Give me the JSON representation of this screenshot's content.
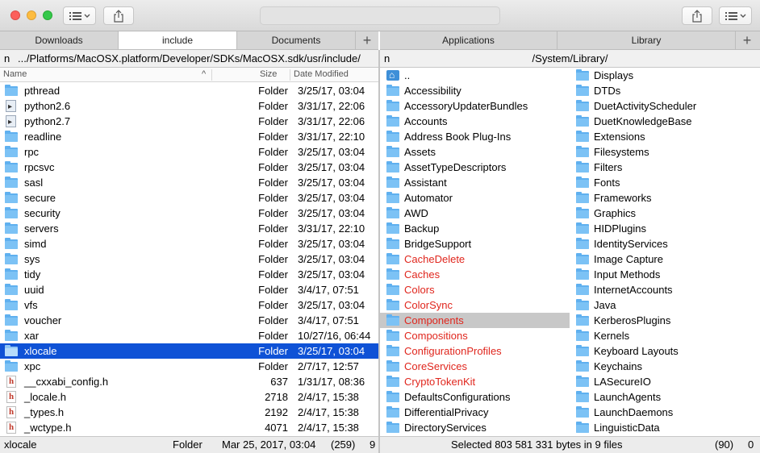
{
  "toolbar": {
    "left_view_icon": "list-view-icon",
    "left_share_icon": "share-icon",
    "right_share_icon": "share-icon",
    "right_view_icon": "list-view-icon"
  },
  "left_tabs": [
    "Downloads",
    "include",
    "Documents"
  ],
  "right_tabs": [
    "Applications",
    "Library"
  ],
  "plus": "+",
  "left_path": {
    "n": "n",
    "path": ".../Platforms/MacOSX.platform/Developer/SDKs/MacOSX.sdk/usr/include/"
  },
  "right_path": {
    "n": "n",
    "path": "/System/Library/"
  },
  "columns": {
    "name": "Name",
    "size": "Size",
    "date": "Date Modified",
    "sort_arrow": "^"
  },
  "left_files": [
    {
      "name": "pthread",
      "size": "Folder",
      "date": "3/25/17, 03:04",
      "icon": "folder"
    },
    {
      "name": "python2.6",
      "size": "Folder",
      "date": "3/31/17, 22:06",
      "icon": "alias"
    },
    {
      "name": "python2.7",
      "size": "Folder",
      "date": "3/31/17, 22:06",
      "icon": "alias"
    },
    {
      "name": "readline",
      "size": "Folder",
      "date": "3/31/17, 22:10",
      "icon": "folder"
    },
    {
      "name": "rpc",
      "size": "Folder",
      "date": "3/25/17, 03:04",
      "icon": "folder"
    },
    {
      "name": "rpcsvc",
      "size": "Folder",
      "date": "3/25/17, 03:04",
      "icon": "folder"
    },
    {
      "name": "sasl",
      "size": "Folder",
      "date": "3/25/17, 03:04",
      "icon": "folder"
    },
    {
      "name": "secure",
      "size": "Folder",
      "date": "3/25/17, 03:04",
      "icon": "folder"
    },
    {
      "name": "security",
      "size": "Folder",
      "date": "3/25/17, 03:04",
      "icon": "folder"
    },
    {
      "name": "servers",
      "size": "Folder",
      "date": "3/31/17, 22:10",
      "icon": "folder"
    },
    {
      "name": "simd",
      "size": "Folder",
      "date": "3/25/17, 03:04",
      "icon": "folder"
    },
    {
      "name": "sys",
      "size": "Folder",
      "date": "3/25/17, 03:04",
      "icon": "folder"
    },
    {
      "name": "tidy",
      "size": "Folder",
      "date": "3/25/17, 03:04",
      "icon": "folder"
    },
    {
      "name": "uuid",
      "size": "Folder",
      "date": "3/4/17, 07:51",
      "icon": "folder"
    },
    {
      "name": "vfs",
      "size": "Folder",
      "date": "3/25/17, 03:04",
      "icon": "folder"
    },
    {
      "name": "voucher",
      "size": "Folder",
      "date": "3/4/17, 07:51",
      "icon": "folder"
    },
    {
      "name": "xar",
      "size": "Folder",
      "date": "10/27/16, 06:44",
      "icon": "folder"
    },
    {
      "name": "xlocale",
      "size": "Folder",
      "date": "3/25/17, 03:04",
      "icon": "folder",
      "selected": true
    },
    {
      "name": "xpc",
      "size": "Folder",
      "date": "2/7/17, 12:57",
      "icon": "folder"
    },
    {
      "name": "__cxxabi_config.h",
      "size": "637",
      "date": "1/31/17, 08:36",
      "icon": "hfile"
    },
    {
      "name": "_locale.h",
      "size": "2718",
      "date": "2/4/17, 15:38",
      "icon": "hfile"
    },
    {
      "name": "_types.h",
      "size": "2192",
      "date": "2/4/17, 15:38",
      "icon": "hfile"
    },
    {
      "name": "_wctype.h",
      "size": "4071",
      "date": "2/4/17, 15:38",
      "icon": "hfile"
    }
  ],
  "right_col1": [
    {
      "name": "..",
      "icon": "up"
    },
    {
      "name": "Accessibility"
    },
    {
      "name": "AccessoryUpdaterBundles"
    },
    {
      "name": "Accounts"
    },
    {
      "name": "Address Book Plug-Ins"
    },
    {
      "name": "Assets"
    },
    {
      "name": "AssetTypeDescriptors"
    },
    {
      "name": "Assistant"
    },
    {
      "name": "Automator"
    },
    {
      "name": "AWD"
    },
    {
      "name": "Backup"
    },
    {
      "name": "BridgeSupport"
    },
    {
      "name": "CacheDelete",
      "red": true
    },
    {
      "name": "Caches",
      "red": true
    },
    {
      "name": "Colors",
      "red": true
    },
    {
      "name": "ColorSync",
      "red": true
    },
    {
      "name": "Components",
      "red": true,
      "highlight": true
    },
    {
      "name": "Compositions",
      "red": true
    },
    {
      "name": "ConfigurationProfiles",
      "red": true
    },
    {
      "name": "CoreServices",
      "red": true
    },
    {
      "name": "CryptoTokenKit",
      "red": true
    },
    {
      "name": "DefaultsConfigurations"
    },
    {
      "name": "DifferentialPrivacy"
    },
    {
      "name": "DirectoryServices"
    }
  ],
  "right_col2": [
    {
      "name": "Displays"
    },
    {
      "name": "DTDs"
    },
    {
      "name": "DuetActivityScheduler"
    },
    {
      "name": "DuetKnowledgeBase"
    },
    {
      "name": "Extensions"
    },
    {
      "name": "Filesystems"
    },
    {
      "name": "Filters"
    },
    {
      "name": "Fonts"
    },
    {
      "name": "Frameworks"
    },
    {
      "name": "Graphics"
    },
    {
      "name": "HIDPlugins"
    },
    {
      "name": "IdentityServices"
    },
    {
      "name": "Image Capture"
    },
    {
      "name": "Input Methods"
    },
    {
      "name": "InternetAccounts"
    },
    {
      "name": "Java"
    },
    {
      "name": "KerberosPlugins"
    },
    {
      "name": "Kernels"
    },
    {
      "name": "Keyboard Layouts"
    },
    {
      "name": "Keychains"
    },
    {
      "name": "LASecureIO"
    },
    {
      "name": "LaunchAgents"
    },
    {
      "name": "LaunchDaemons"
    },
    {
      "name": "LinguisticData"
    }
  ],
  "left_status": {
    "name": "xlocale",
    "kind": "Folder",
    "date": "Mar 25, 2017, 03:04",
    "count": "(259)",
    "extra": "9"
  },
  "right_status": {
    "text": "Selected 803 581 331 bytes in 9 files",
    "count": "(90)",
    "extra": "0"
  },
  "colors": {
    "selection": "#0f52d6",
    "red_label": "#e0261d",
    "folder": "#5fb0ef"
  }
}
